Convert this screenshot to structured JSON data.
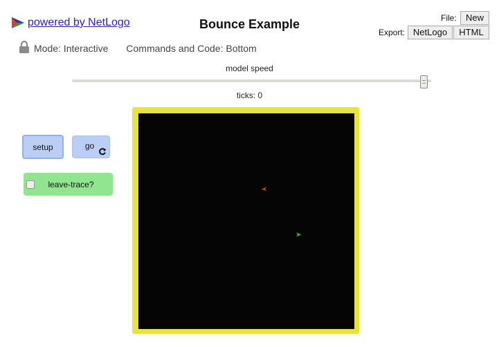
{
  "header": {
    "powered_by": "powered by NetLogo",
    "title": "Bounce Example",
    "file_label": "File:",
    "new_label": "New",
    "export_label": "Export:",
    "export_netlogo_label": "NetLogo",
    "export_html_label": "HTML"
  },
  "mode": {
    "mode_text": "Mode: Interactive",
    "commands_text": "Commands and Code: Bottom",
    "lock_icon": "lock-icon"
  },
  "speed": {
    "label": "model speed",
    "value_fraction": 0.98
  },
  "ticks": {
    "text": "ticks: 0"
  },
  "widgets": {
    "setup_label": "setup",
    "go_label": "go",
    "go_forever_icon": "forever-icon",
    "switch_label": "leave-trace?",
    "switch_on": false
  },
  "colors": {
    "button_bg": "#bacff3",
    "switch_bg": "#90e58e",
    "view_border": "#e9e43c",
    "world_bg": "#050505",
    "turtle_red": "#d9432a",
    "turtle_green": "#3ec44a"
  }
}
